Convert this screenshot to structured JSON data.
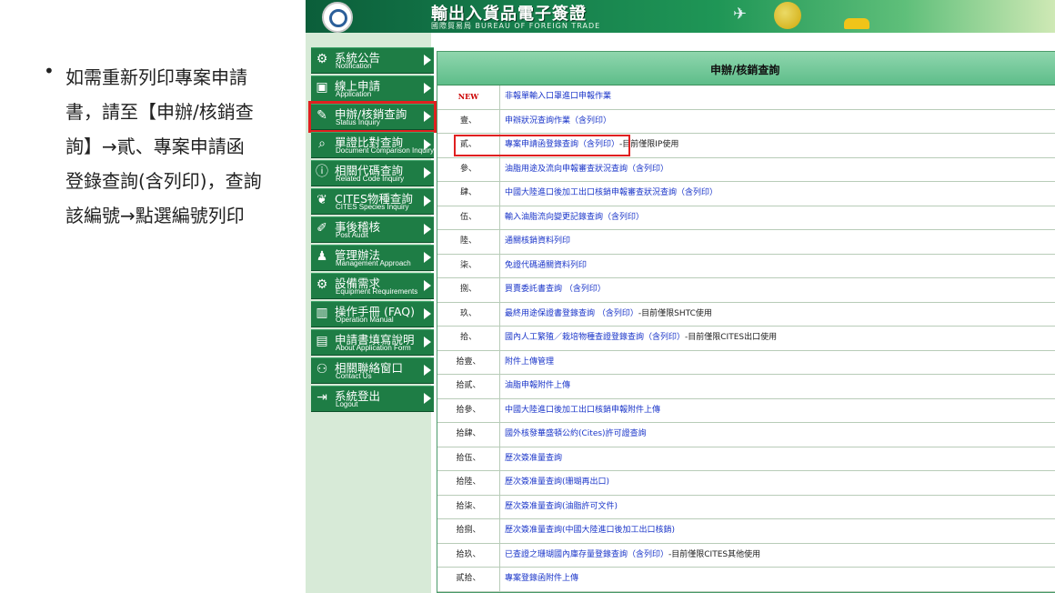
{
  "slide": {
    "bullet": "•",
    "lines": [
      "如需重新列印專案申請",
      "書，請至【申辦/核銷查",
      "詢】→貳、專案申請函",
      "登錄查詢(含列印)，查詢",
      "該編號→點選編號列印"
    ]
  },
  "banner": {
    "title": "輸出入貨品電子簽證",
    "subtitle": "國際貿易局 BUREAU OF FOREIGN TRADE"
  },
  "menu": [
    {
      "zh": "系統公告",
      "en": "Notification",
      "icon": "speaker-icon",
      "glyph": "⚙"
    },
    {
      "zh": "線上申請",
      "en": "Application",
      "icon": "monitor-icon",
      "glyph": "▣"
    },
    {
      "zh": "申辦/核銷查詢",
      "en": "Status Inquiry",
      "icon": "document-edit-icon",
      "glyph": "✎",
      "active": true
    },
    {
      "zh": "單證比對查詢",
      "en": "Document Comparison Inquiry",
      "icon": "magnifier-icon",
      "glyph": "⌕"
    },
    {
      "zh": "相關代碼查詢",
      "en": "Related Code Inquiry",
      "icon": "info-icon",
      "glyph": "ⓘ"
    },
    {
      "zh": "CITES物種查詢",
      "en": "CITES Species Inquiry",
      "icon": "leaf-icon",
      "glyph": "❦"
    },
    {
      "zh": "事後稽核",
      "en": "Post Audit",
      "icon": "pencil-icon",
      "glyph": "✐"
    },
    {
      "zh": "管理辦法",
      "en": "Management Approach",
      "icon": "person-icon",
      "glyph": "♟"
    },
    {
      "zh": "設備需求",
      "en": "Equipment Requirements",
      "icon": "gear-icon",
      "glyph": "⚙"
    },
    {
      "zh": "操作手冊 (FAQ)",
      "en": "Operation Manual",
      "icon": "book-icon",
      "glyph": "▥"
    },
    {
      "zh": "申請書填寫說明",
      "en": "About Application Form",
      "icon": "form-icon",
      "glyph": "▤"
    },
    {
      "zh": "相關聯絡窗口",
      "en": "Contact Us",
      "icon": "network-icon",
      "glyph": "⚇"
    },
    {
      "zh": "系統登出",
      "en": "Logout",
      "icon": "logout-icon",
      "glyph": "⇥"
    }
  ],
  "panel": {
    "title": "申辦/核銷查詢",
    "rows": [
      {
        "num": "NEW",
        "link": "非報單輸入口罩進口申報作業",
        "note": ""
      },
      {
        "num": "壹、",
        "link": "申辦狀況查詢作業（含列印）",
        "note": ""
      },
      {
        "num": "貳、",
        "link": "專案申請函登錄查詢（含列印）",
        "note": "-目前僅限IP使用"
      },
      {
        "num": "參、",
        "link": "油脂用途及流向申報審查狀況查詢（含列印）",
        "note": ""
      },
      {
        "num": "肆、",
        "link": "中國大陸進口後加工出口核銷申報審查狀況查詢（含列印）",
        "note": ""
      },
      {
        "num": "伍、",
        "link": "輸入油脂流向變更記錄查詢（含列印）",
        "note": ""
      },
      {
        "num": "陸、",
        "link": "通關核銷資料列印",
        "note": ""
      },
      {
        "num": "柒、",
        "link": "免證代碼通關資料列印",
        "note": ""
      },
      {
        "num": "捌、",
        "link": "買賣委託書查詢 （含列印）",
        "note": ""
      },
      {
        "num": "玖、",
        "link": "最終用途保證書登錄查詢 （含列印）",
        "note": "-目前僅限SHTC使用"
      },
      {
        "num": "拾、",
        "link": "國內人工繁殖／栽培物種查證登錄查詢（含列印）",
        "note": "-目前僅限CITES出口使用"
      },
      {
        "num": "拾壹、",
        "link": "附件上傳管理",
        "note": ""
      },
      {
        "num": "拾貳、",
        "link": "油脂申報附件上傳",
        "note": ""
      },
      {
        "num": "拾參、",
        "link": "中國大陸進口後加工出口核銷申報附件上傳",
        "note": ""
      },
      {
        "num": "拾肆、",
        "link": "國外核發華盛頓公約(Cites)許可證查詢",
        "note": ""
      },
      {
        "num": "拾伍、",
        "link": "歷次簽准量查詢",
        "note": ""
      },
      {
        "num": "拾陸、",
        "link": "歷次簽准量查詢(珊瑚再出口)",
        "note": ""
      },
      {
        "num": "拾柒、",
        "link": "歷次簽准量查詢(油脂許可文件)",
        "note": ""
      },
      {
        "num": "拾捌、",
        "link": "歷次簽准量查詢(中國大陸進口後加工出口核銷)",
        "note": ""
      },
      {
        "num": "拾玖、",
        "link": "已查證之珊瑚國內庫存量登錄查詢（含列印）",
        "note": "-目前僅限CITES其他使用"
      },
      {
        "num": "貳拾、",
        "link": "專案登錄函附件上傳",
        "note": ""
      }
    ]
  },
  "colors": {
    "accent": "#1e7d45",
    "highlight": "#e02020",
    "link": "#1a35c9"
  }
}
